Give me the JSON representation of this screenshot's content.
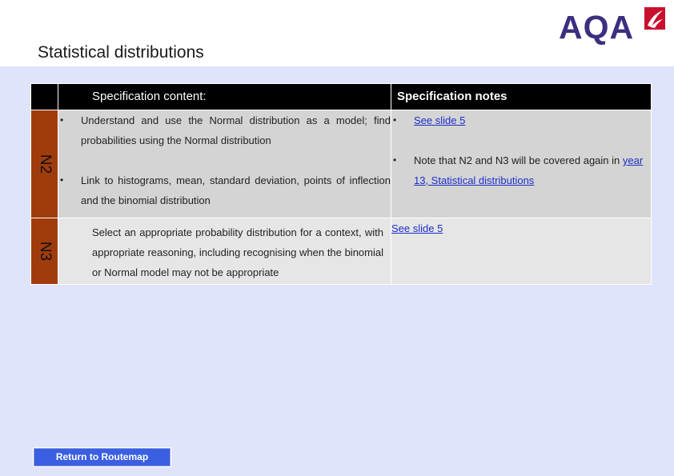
{
  "page": {
    "title": "Statistical distributions",
    "logo_text": "AQA",
    "colors": {
      "background": "#e0e4fa",
      "header_cell": "#000000",
      "code_cell": "#a03c0c",
      "row_n2": "#d4d4d4",
      "row_n3": "#e6e6e6",
      "link": "#1a2ec8",
      "logo": "#3b2f7f",
      "logo_mark": "#c8102e",
      "button": "#3a5fe0"
    }
  },
  "table": {
    "header_content": "Specification content:",
    "header_notes": "Specification notes",
    "rows": [
      {
        "code": "N2",
        "content_items": [
          "Understand and use the Normal distribution as a model; find probabilities using the Normal distribution",
          "Link to histograms, mean, standard deviation, points of inflection and the binomial distribution"
        ],
        "notes": {
          "link1": "See slide 5",
          "note_text": "Note that N2 and N3 will be covered again in",
          "link2": "year 13, Statistical distributions"
        }
      },
      {
        "code": "N3",
        "content": "Select an appropriate probability distribution for a context, with appropriate reasoning, including recognising when the binomial or Normal model may not be appropriate",
        "notes_link": "See slide 5"
      }
    ]
  },
  "buttons": {
    "routemap": "Return to Routemap"
  },
  "icons": {
    "logo_mark": "aqa-swoosh-icon"
  }
}
